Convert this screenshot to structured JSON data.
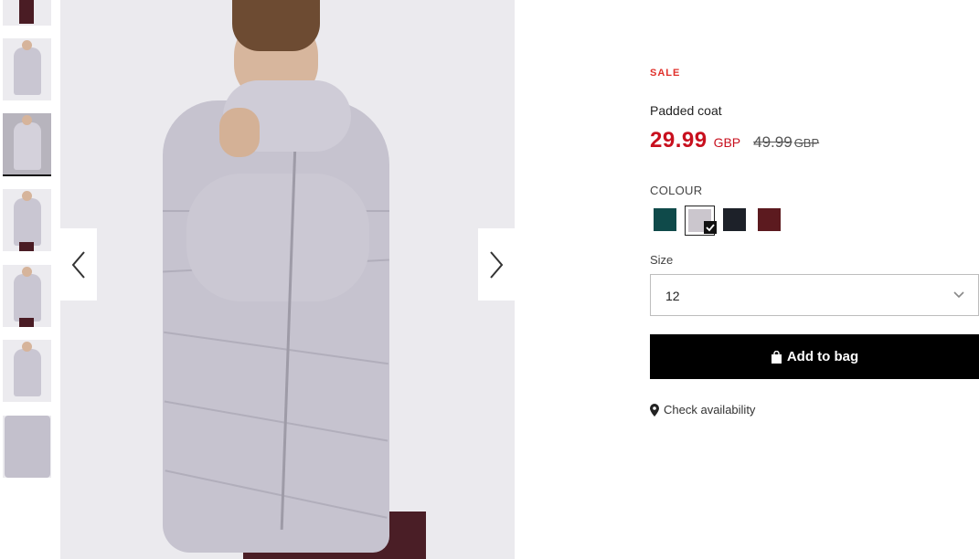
{
  "product": {
    "badge": "SALE",
    "title": "Padded coat",
    "price_current": "29.99",
    "currency_current": "GBP",
    "price_old": "49.99",
    "currency_old": "GBP",
    "colour_label": "COLOUR",
    "colours": [
      {
        "name": "dark-teal",
        "hex": "#0f4a4a",
        "selected": false
      },
      {
        "name": "light-grey",
        "hex": "#cbc6cd",
        "selected": true
      },
      {
        "name": "navy-black",
        "hex": "#1d2129",
        "selected": false
      },
      {
        "name": "burgundy",
        "hex": "#5c1a1f",
        "selected": false
      }
    ],
    "size_label": "Size",
    "size_value": "12",
    "add_to_bag_label": "Add to bag",
    "check_availability_label": "Check availability"
  },
  "gallery": {
    "thumbnail_count": 7,
    "active_thumbnail": 2
  },
  "colors": {
    "sale_red": "#e0312c",
    "price_red": "#c8101e",
    "button_bg": "#000000"
  },
  "icons": [
    "chevron-left-icon",
    "chevron-right-icon",
    "chevron-down-icon",
    "checkmark-icon",
    "shopping-bag-icon",
    "map-pin-icon"
  ]
}
